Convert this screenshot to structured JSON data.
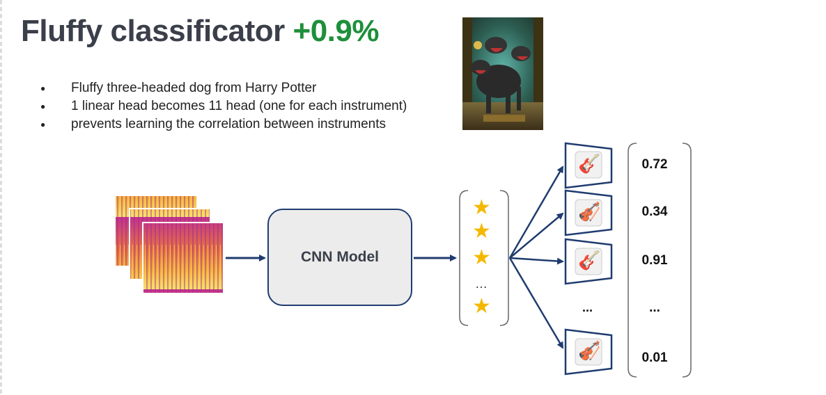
{
  "title": {
    "main": "Fluffy classificator",
    "accent": "+0.9%"
  },
  "bullets": [
    "Fluffy three-headed dog from Harry Potter",
    "1 linear head becomes 11 head (one for each instrument)",
    "prevents learning the correlation between instruments"
  ],
  "colors": {
    "title": "#3a3f4a",
    "accent": "#1e8f3a",
    "arrow": "#1f3b6f",
    "star": "#f5b800"
  },
  "diagram": {
    "model_label": "CNN Model",
    "feature_ellipsis": "…",
    "heads": [
      {
        "icon": "acoustic-guitar-icon",
        "glyph": "🎸",
        "probability": "0.72"
      },
      {
        "icon": "violin-icon",
        "glyph": "🎻",
        "probability": "0.34"
      },
      {
        "icon": "electric-guitar-icon",
        "glyph": "🎸",
        "probability": "0.91"
      },
      {
        "icon": "violin-bow-icon",
        "glyph": "🎻",
        "probability": "0.01"
      }
    ],
    "heads_ellipsis": "...",
    "probs_ellipsis": "..."
  }
}
